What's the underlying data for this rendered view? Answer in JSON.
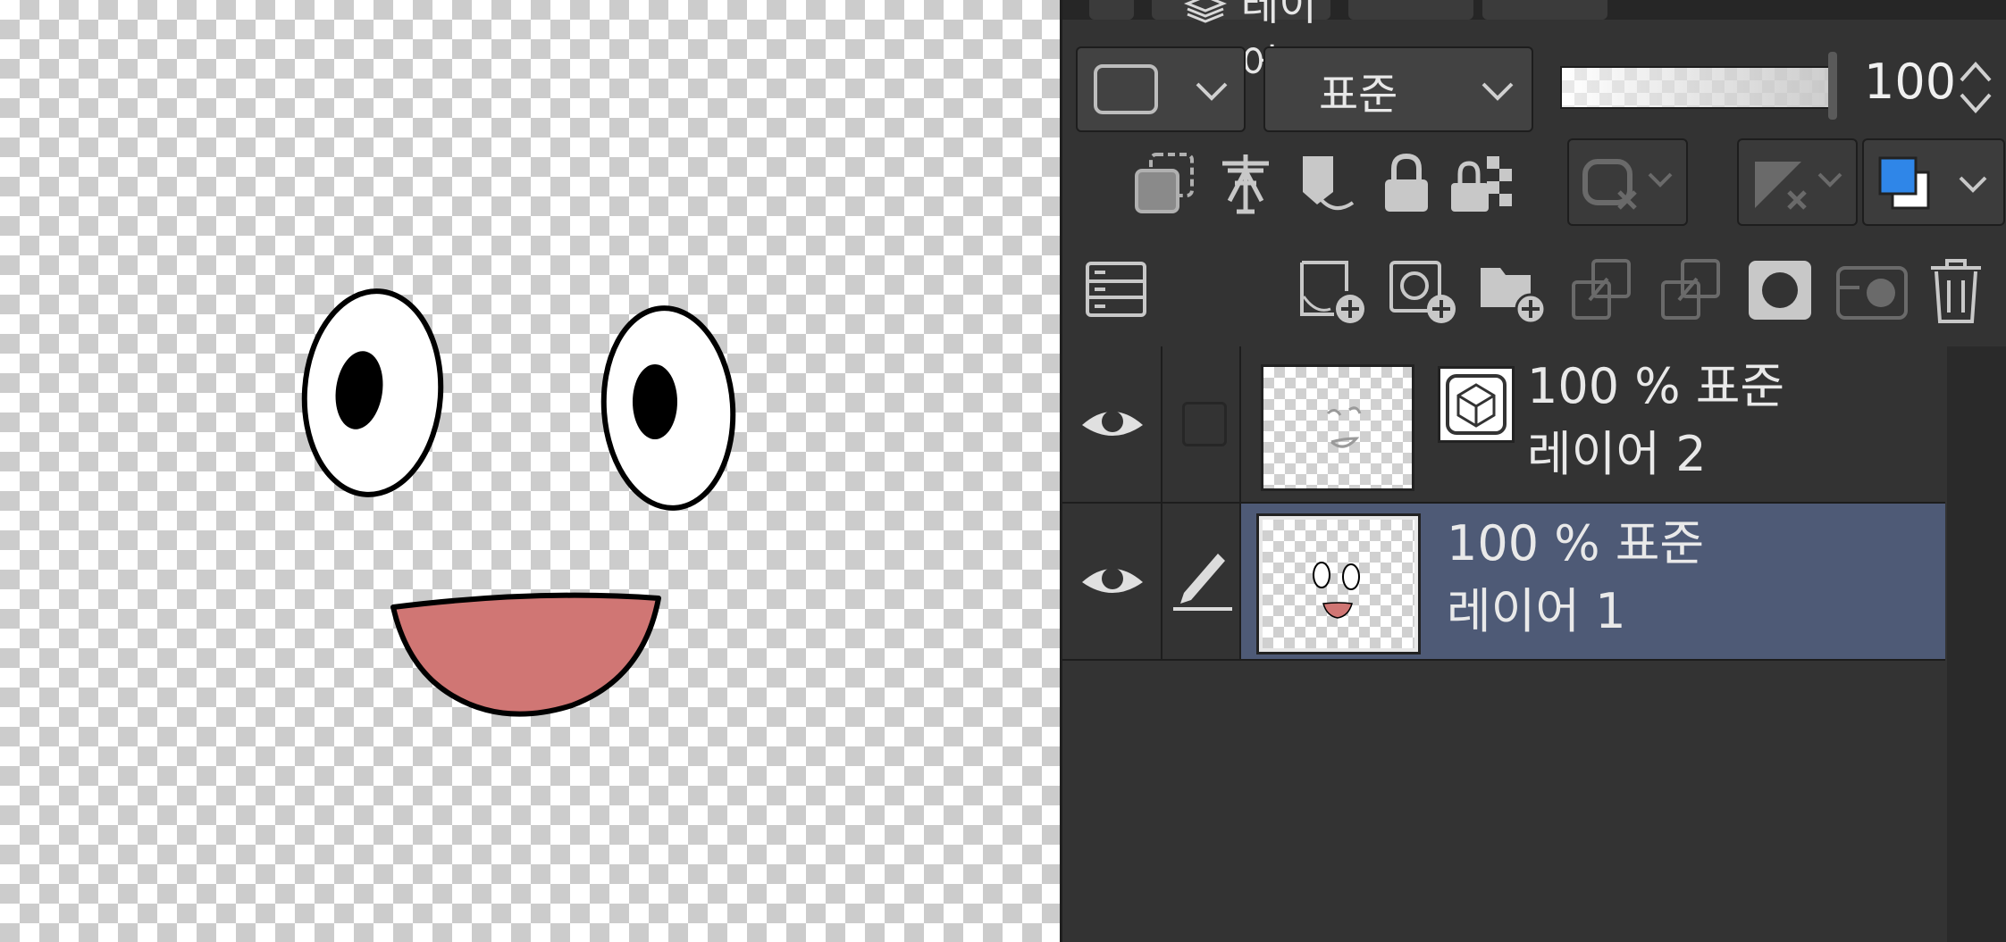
{
  "panel": {
    "tab_label": "레이어",
    "blend_mode": "표준",
    "opacity_value": "100"
  },
  "layers": [
    {
      "opacity": "100 %",
      "blend": "표준",
      "name": "레이어 2",
      "visible": true,
      "selected": false,
      "has_material_icon": true
    },
    {
      "opacity": "100 %",
      "blend": "표준",
      "name": "레이어 1",
      "visible": true,
      "selected": true,
      "has_material_icon": false
    }
  ],
  "colors": {
    "accent_blue": "#2f86e8",
    "mouth": "#d07674",
    "selected_row": "#4e5a76"
  },
  "icons": [
    "layer-color-icon",
    "chevron-down-icon",
    "layer-clipping-icon",
    "reference-layer-icon",
    "draft-layer-icon",
    "lock-icon",
    "lock-transparent-icon",
    "mask-icon",
    "ruler-icon",
    "layer-color-swatch-icon",
    "layer-property-icon",
    "new-raster-layer-icon",
    "new-vector-layer-icon",
    "new-folder-icon",
    "merge-down-icon",
    "merge-visible-icon",
    "create-mask-icon",
    "apply-mask-icon",
    "delete-layer-icon",
    "eye-icon",
    "pencil-icon",
    "3d-material-icon"
  ]
}
